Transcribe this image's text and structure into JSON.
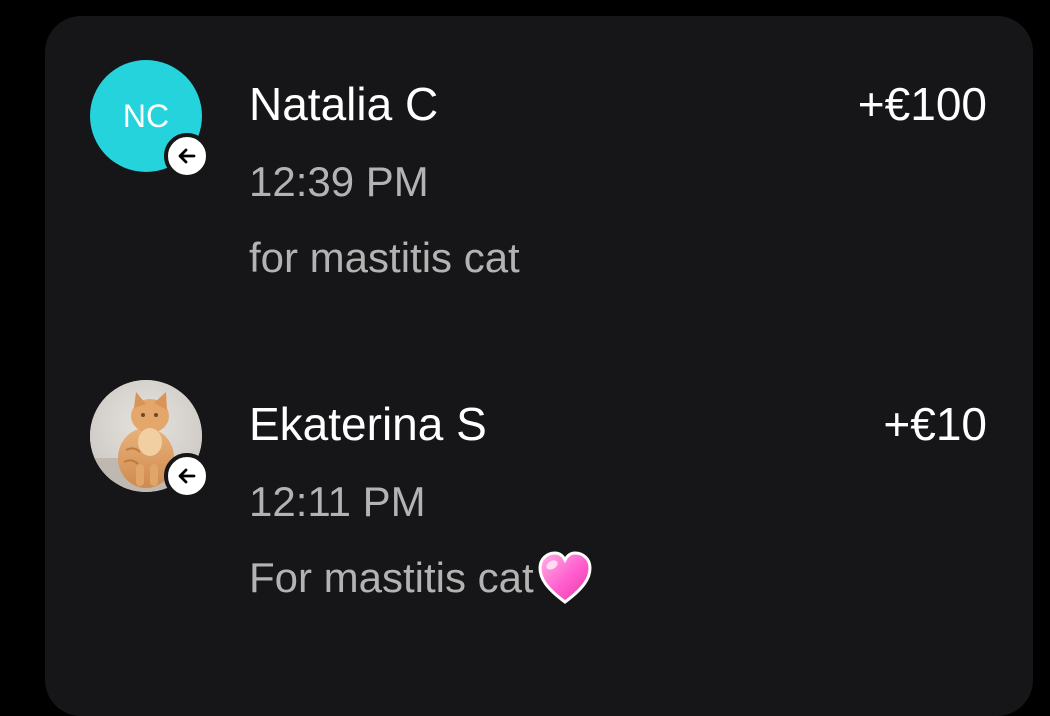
{
  "transactions": [
    {
      "avatar_initials": "NC",
      "avatar_color": "#25d3dd",
      "direction_icon": "arrow-left-icon",
      "name": "Natalia C",
      "amount": "+€100",
      "time": "12:39 PM",
      "note": "for mastitis cat"
    },
    {
      "avatar_image": "cat-photo",
      "direction_icon": "arrow-left-icon",
      "name": "Ekaterina S",
      "amount": "+€10",
      "time": "12:11 PM",
      "note": "For mastitis cat",
      "note_emoji": "pink-heart-icon"
    }
  ],
  "colors": {
    "background": "#000000",
    "card": "#161618",
    "primary_text": "#ffffff",
    "secondary_text": "#b3b3b3"
  }
}
